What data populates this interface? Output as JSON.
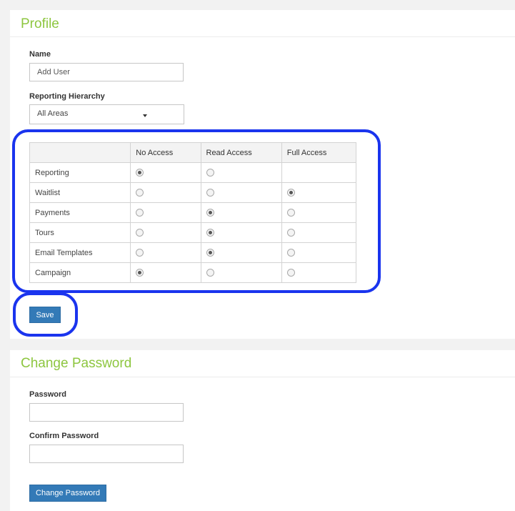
{
  "profile": {
    "title": "Profile",
    "name_label": "Name",
    "name_value": "Add User",
    "hierarchy_label": "Reporting Hierarchy",
    "hierarchy_value": "All Areas",
    "columns": [
      "",
      "No Access",
      "Read Access",
      "Full Access"
    ],
    "rows": [
      {
        "label": "Reporting",
        "options": [
          "checked",
          "unchecked",
          "none"
        ]
      },
      {
        "label": "Waitlist",
        "options": [
          "unchecked",
          "unchecked",
          "checked"
        ]
      },
      {
        "label": "Payments",
        "options": [
          "unchecked",
          "checked",
          "unchecked"
        ]
      },
      {
        "label": "Tours",
        "options": [
          "unchecked",
          "checked",
          "unchecked"
        ]
      },
      {
        "label": "Email Templates",
        "options": [
          "unchecked",
          "checked",
          "unchecked"
        ]
      },
      {
        "label": "Campaign",
        "options": [
          "checked",
          "unchecked",
          "unchecked"
        ]
      }
    ],
    "save_label": "Save"
  },
  "password": {
    "title": "Change Password",
    "password_label": "Password",
    "password_value": "",
    "confirm_label": "Confirm Password",
    "confirm_value": "",
    "button_label": "Change Password"
  },
  "annotation_color": "#1a34ee",
  "accent_color": "#8dc63f",
  "button_color": "#337ab7"
}
